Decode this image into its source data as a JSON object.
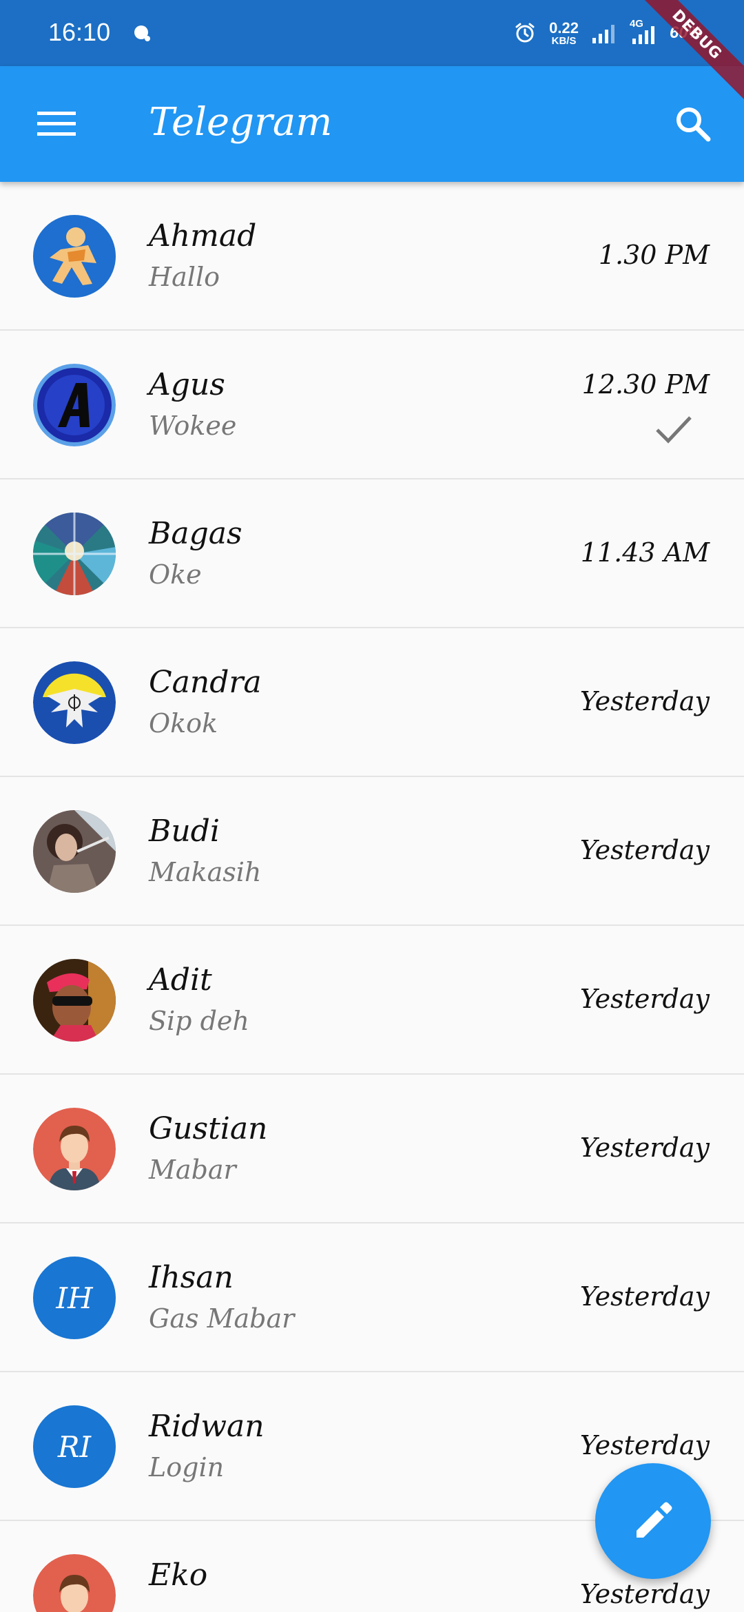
{
  "status_bar": {
    "time": "16:10",
    "net_speed_value": "0.22",
    "net_speed_unit": "KB/S",
    "network_type": "4G",
    "battery": "60%",
    "icons": [
      "message-dot-icon",
      "alarm-icon",
      "signal-icon",
      "4g-signal-icon",
      "battery-icon"
    ]
  },
  "debug_banner": "DEBUG",
  "app_bar": {
    "title": "Telegram",
    "menu_icon": "menu-icon",
    "search_icon": "search-icon",
    "background": "#2196f3"
  },
  "chats": [
    {
      "name": "Ahmad",
      "message": "Hallo",
      "time": "1.30 PM",
      "read": false,
      "avatar": "photo"
    },
    {
      "name": "Agus",
      "message": "Wokee",
      "time": "12.30 PM",
      "read": true,
      "avatar": "photo"
    },
    {
      "name": "Bagas",
      "message": "Oke",
      "time": "11.43 AM",
      "read": false,
      "avatar": "photo"
    },
    {
      "name": "Candra",
      "message": "Okok",
      "time": "Yesterday",
      "read": false,
      "avatar": "photo"
    },
    {
      "name": "Budi",
      "message": "Makasih",
      "time": "Yesterday",
      "read": false,
      "avatar": "photo"
    },
    {
      "name": "Adit",
      "message": "Sip deh",
      "time": "Yesterday",
      "read": false,
      "avatar": "photo"
    },
    {
      "name": "Gustian",
      "message": "Mabar",
      "time": "Yesterday",
      "read": false,
      "avatar": "illustration"
    },
    {
      "name": "Ihsan",
      "message": "Gas Mabar",
      "time": "Yesterday",
      "read": false,
      "avatar": "initials",
      "initials": "IH"
    },
    {
      "name": "Ridwan",
      "message": "Login",
      "time": "Yesterday",
      "read": false,
      "avatar": "initials",
      "initials": "RI"
    },
    {
      "name": "Eko",
      "message": "",
      "time": "Yesterday",
      "read": false,
      "avatar": "illustration"
    }
  ],
  "fab": {
    "icon": "pencil-icon",
    "color": "#2196f3"
  }
}
